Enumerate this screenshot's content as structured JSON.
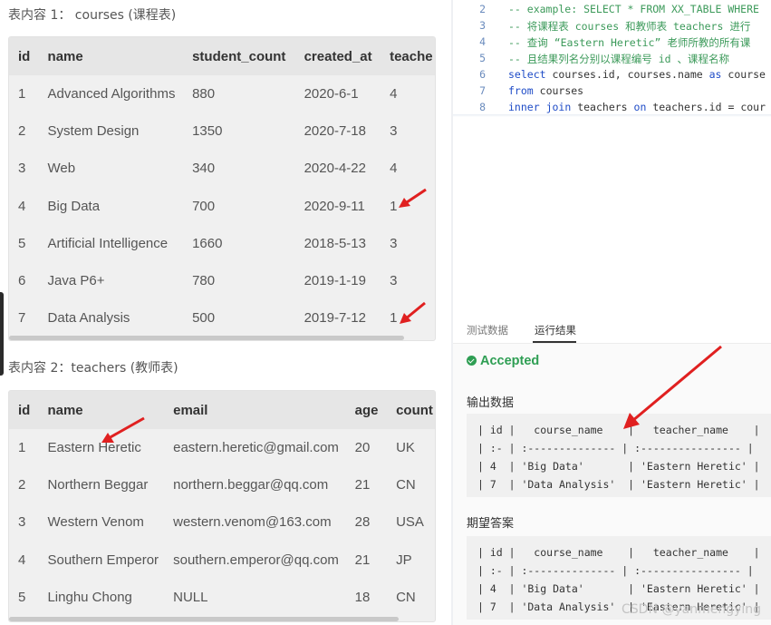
{
  "courses_table": {
    "caption": "表内容 1： courses (课程表)",
    "columns": [
      "id",
      "name",
      "student_count",
      "created_at",
      "teache"
    ],
    "rows": [
      [
        "1",
        "Advanced Algorithms",
        "880",
        "2020-6-1",
        "4"
      ],
      [
        "2",
        "System Design",
        "1350",
        "2020-7-18",
        "3"
      ],
      [
        "3",
        "Web",
        "340",
        "2020-4-22",
        "4"
      ],
      [
        "4",
        "Big Data",
        "700",
        "2020-9-11",
        "1"
      ],
      [
        "5",
        "Artificial Intelligence",
        "1660",
        "2018-5-13",
        "3"
      ],
      [
        "6",
        "Java P6+",
        "780",
        "2019-1-19",
        "3"
      ],
      [
        "7",
        "Data Analysis",
        "500",
        "2019-7-12",
        "1"
      ]
    ]
  },
  "teachers_table": {
    "caption": "表内容 2：teachers (教师表)",
    "columns": [
      "id",
      "name",
      "email",
      "age",
      "count"
    ],
    "rows": [
      [
        "1",
        "Eastern Heretic",
        "eastern.heretic@gmail.com",
        "20",
        "UK"
      ],
      [
        "2",
        "Northern Beggar",
        "northern.beggar@qq.com",
        "21",
        "CN"
      ],
      [
        "3",
        "Western Venom",
        "western.venom@163.com",
        "28",
        "USA"
      ],
      [
        "4",
        "Southern Emperor",
        "southern.emperor@qq.com",
        "21",
        "JP"
      ],
      [
        "5",
        "Linghu Chong",
        "NULL",
        "18",
        "CN"
      ]
    ]
  },
  "editor": {
    "lines": [
      {
        "num": "2",
        "text": "-- example: SELECT * FROM XX_TABLE WHERE",
        "kind": "comment"
      },
      {
        "num": "3",
        "text": "-- 将课程表 courses 和教师表 teachers 进行",
        "kind": "comment"
      },
      {
        "num": "4",
        "text": "-- 查询 “Eastern Heretic” 老师所教的所有课",
        "kind": "comment"
      },
      {
        "num": "5",
        "text": "-- 且结果列名分别以课程编号 id 、课程名称",
        "kind": "comment"
      },
      {
        "num": "6",
        "text": "select courses.id, courses.name as course",
        "kind": "code"
      },
      {
        "num": "7",
        "text": "from courses",
        "kind": "code"
      },
      {
        "num": "8",
        "text": "inner join teachers on teachers.id = cour",
        "kind": "code"
      }
    ]
  },
  "result_panel": {
    "tab_test_data": "测试数据",
    "tab_run_result": "运行结果",
    "status": "Accepted",
    "output_title": "输出数据",
    "output_md": "| id |   course_name    |   teacher_name    |\n| :- | :-------------- | :---------------- |\n| 4  | 'Big Data'       | 'Eastern Heretic' |\n| 7  | 'Data Analysis'  | 'Eastern Heretic' |",
    "expected_title": "期望答案",
    "expected_md": "| id |   course_name    |   teacher_name    |\n| :- | :-------------- | :---------------- |\n| 4  | 'Big Data'       | 'Eastern Heretic' |\n| 7  | 'Data Analysis'  | 'Eastern Heretic' |",
    "watermark": "CSDN @yanmengying"
  },
  "colors": {
    "accepted": "#2e9e53",
    "link": "#1a9bd7",
    "arrow": "#e02020",
    "comment": "#3c9a5a",
    "keyword": "#1f4cc7"
  }
}
